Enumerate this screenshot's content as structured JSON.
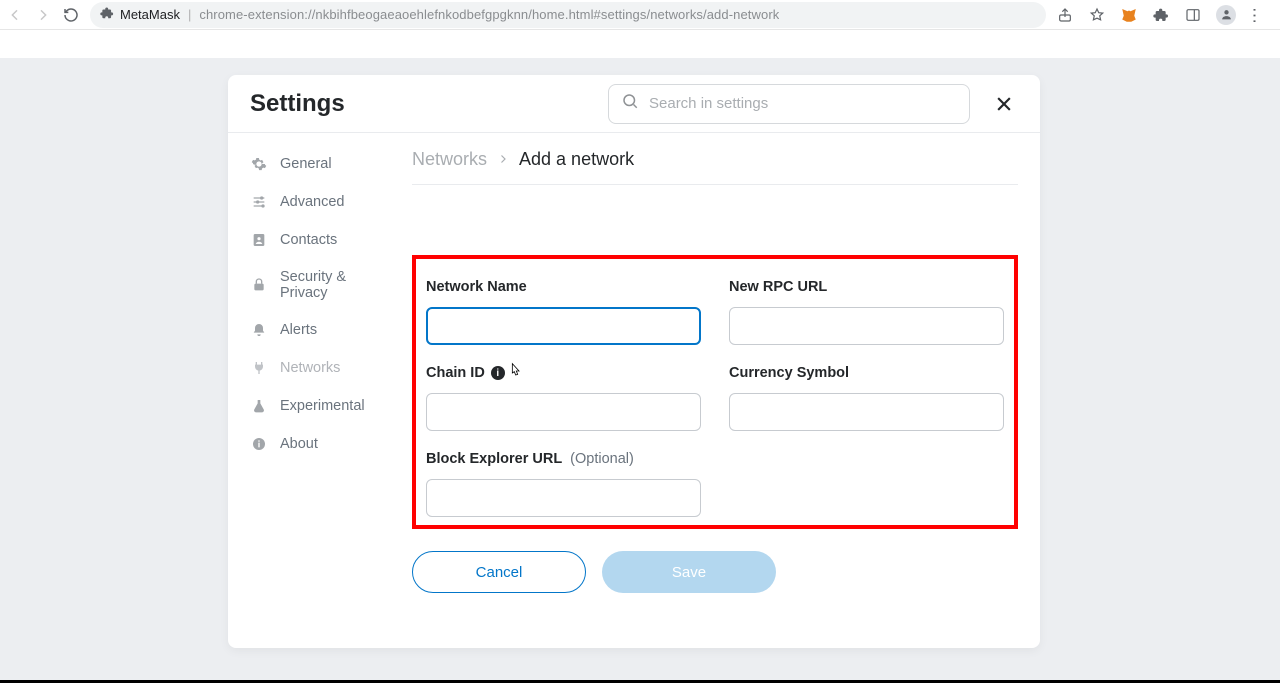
{
  "browser": {
    "app_name": "MetaMask",
    "url": "chrome-extension://nkbihfbeogaeaoehlefnkodbefgpgknn/home.html#settings/networks/add-network"
  },
  "panel": {
    "title": "Settings",
    "search_placeholder": "Search in settings"
  },
  "sidebar": {
    "items": [
      {
        "label": "General"
      },
      {
        "label": "Advanced"
      },
      {
        "label": "Contacts"
      },
      {
        "label": "Security & Privacy"
      },
      {
        "label": "Alerts"
      },
      {
        "label": "Networks"
      },
      {
        "label": "Experimental"
      },
      {
        "label": "About"
      }
    ]
  },
  "breadcrumb": {
    "root": "Networks",
    "leaf": "Add a network"
  },
  "form": {
    "network_name_label": "Network Name",
    "rpc_label": "New RPC URL",
    "chain_id_label": "Chain ID",
    "currency_label": "Currency Symbol",
    "explorer_label": "Block Explorer URL",
    "explorer_optional": "(Optional)"
  },
  "buttons": {
    "cancel": "Cancel",
    "save": "Save"
  }
}
